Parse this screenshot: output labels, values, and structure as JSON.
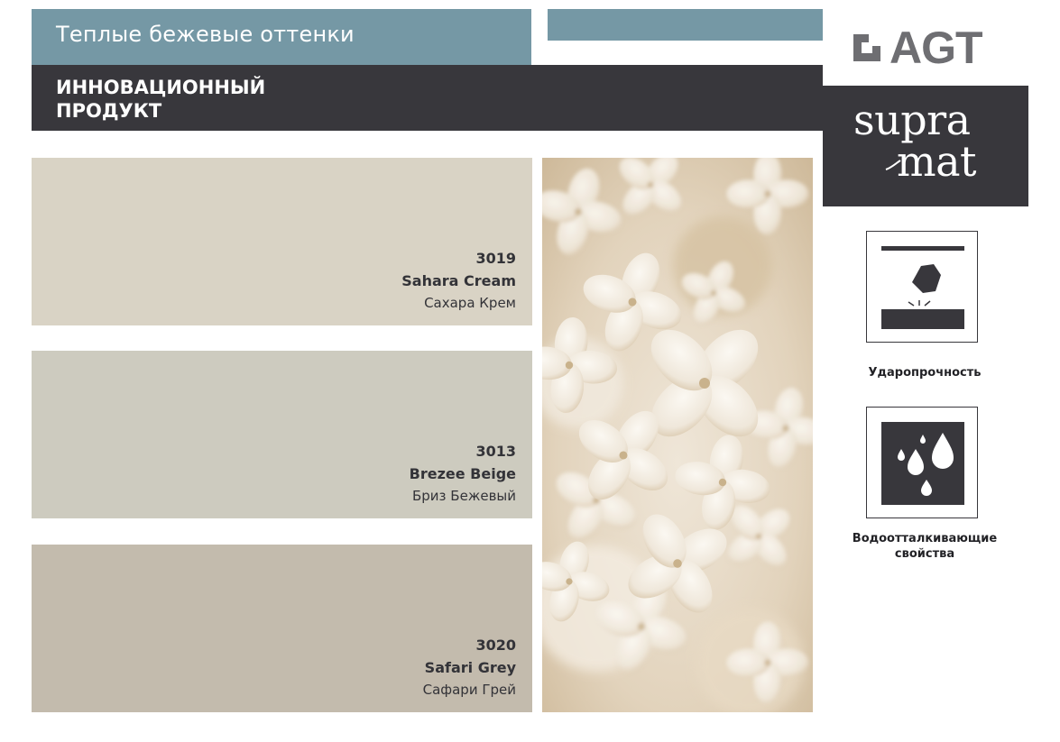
{
  "header": {
    "title": "Теплые бежевые оттенки",
    "subtitle": "ИННОВАЦИОННЫЙ\nПРОДУКТ"
  },
  "brand": {
    "agt": "AGT",
    "line1": "supra",
    "line2": "mat"
  },
  "swatches": [
    {
      "code": "3019",
      "name": "Sahara Cream",
      "name_ru": "Сахара Крем",
      "color": "#d9d3c5"
    },
    {
      "code": "3013",
      "name": "Brezee Beige",
      "name_ru": "Бриз Бежевый",
      "color": "#cdcbbf"
    },
    {
      "code": "3020",
      "name": "Safari Grey",
      "name_ru": "Сафари Грей",
      "color": "#c3bbad"
    }
  ],
  "features": [
    {
      "icon": "impact-resistance-icon",
      "label": "Ударопрочность"
    },
    {
      "icon": "water-repellent-icon",
      "label": "Водоотталкивающие\nсвойства"
    }
  ],
  "colors": {
    "accent_blue": "#7598a5",
    "dark": "#38373c",
    "logo_grey": "#6e6e72"
  }
}
